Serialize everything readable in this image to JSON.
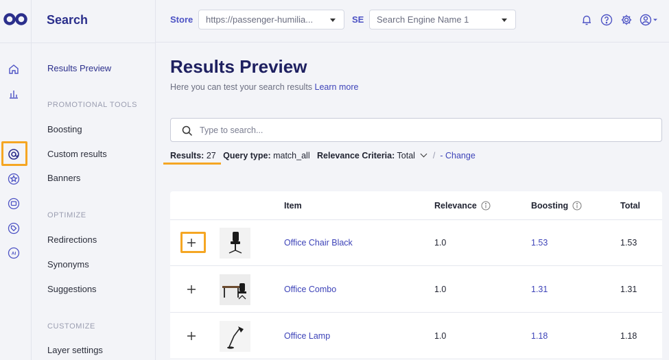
{
  "sidebar": {
    "title": "Search",
    "active_item": "Results Preview",
    "groups": [
      {
        "label": "PROMOTIONAL TOOLS",
        "items": [
          "Boosting",
          "Custom results",
          "Banners"
        ]
      },
      {
        "label": "OPTIMIZE",
        "items": [
          "Redirections",
          "Synonyms",
          "Suggestions"
        ]
      },
      {
        "label": "CUSTOMIZE",
        "items": [
          "Layer settings"
        ]
      }
    ]
  },
  "header": {
    "store_label": "Store",
    "store_value": "https://passenger-humilia...",
    "se_label": "SE",
    "se_placeholder": "Search Engine Name 1"
  },
  "page": {
    "title": "Results Preview",
    "subtitle": "Here you can test your search results",
    "learn_more": "Learn more",
    "search_placeholder": "Type to search..."
  },
  "meta": {
    "results_label": "Results:",
    "results_value": "27",
    "query_label": "Query type:",
    "query_value": "match_all",
    "criteria_label": "Relevance Criteria:",
    "criteria_value": "Total",
    "separator": "/",
    "dash": "-",
    "change": "Change"
  },
  "table": {
    "columns": {
      "item": "Item",
      "relevance": "Relevance",
      "boosting": "Boosting",
      "total": "Total"
    },
    "rows": [
      {
        "item": "Office Chair Black",
        "relevance": "1.0",
        "boosting": "1.53",
        "total": "1.53"
      },
      {
        "item": "Office Combo",
        "relevance": "1.0",
        "boosting": "1.31",
        "total": "1.31"
      },
      {
        "item": "Office Lamp",
        "relevance": "1.0",
        "boosting": "1.18",
        "total": "1.18"
      }
    ]
  },
  "colors": {
    "accent": "#2b2f8c",
    "link": "#3d43b8",
    "highlight": "#f5a623"
  }
}
